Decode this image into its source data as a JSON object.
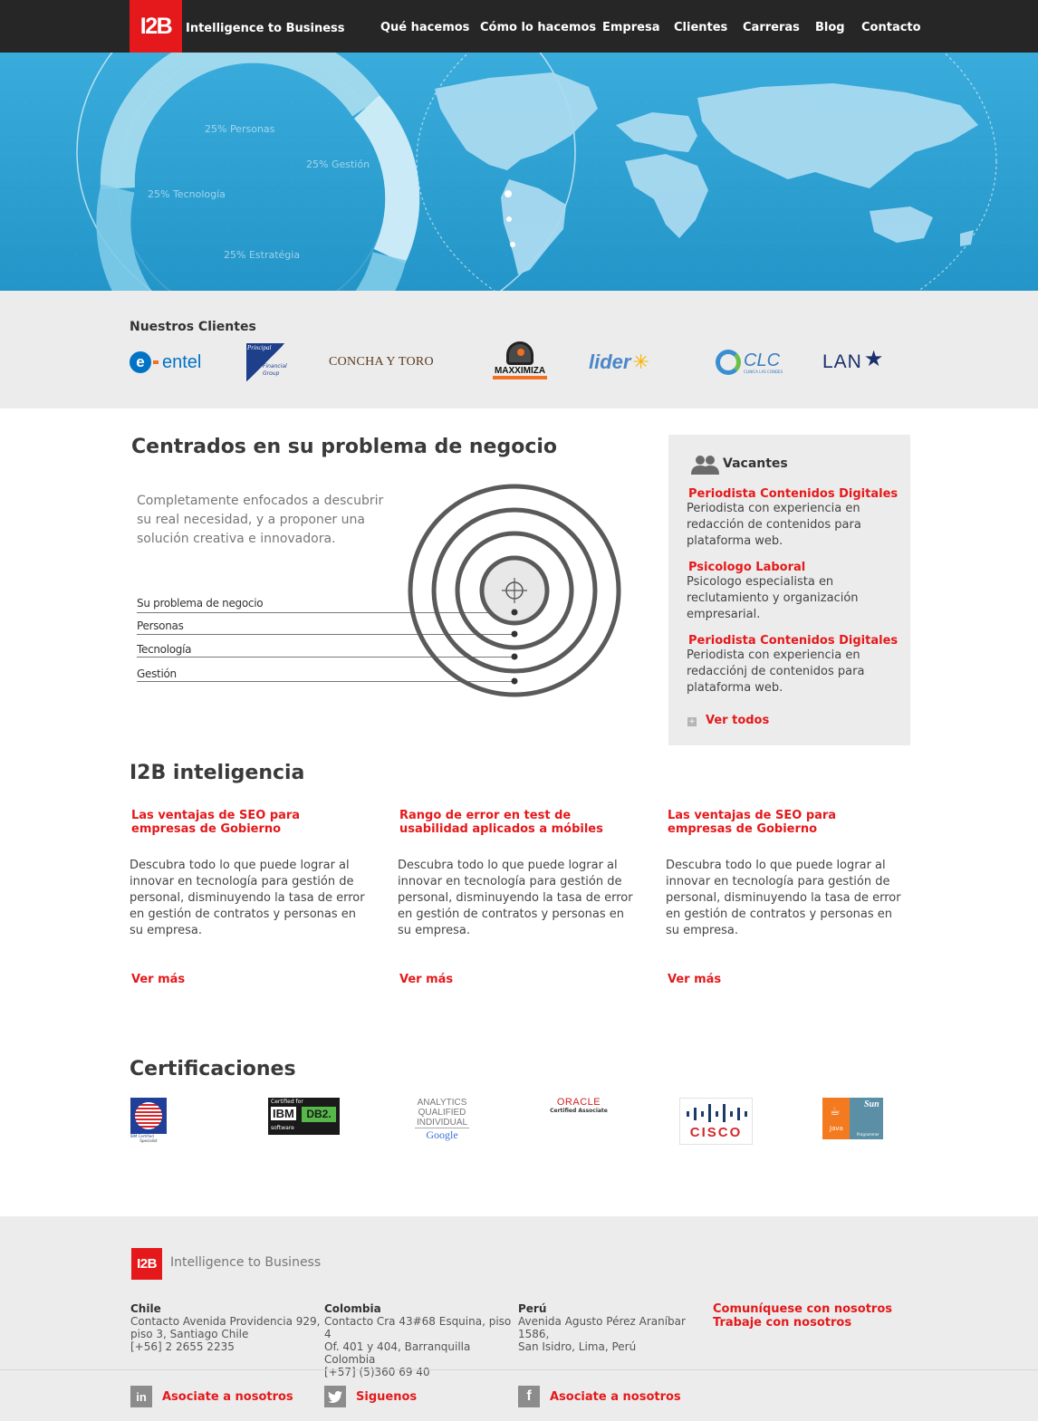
{
  "brand": {
    "logo": "I2B",
    "tagline": "Intelligence to Business"
  },
  "nav": [
    {
      "label": "Qué hacemos"
    },
    {
      "label": "Cómo lo hacemos"
    },
    {
      "label": "Empresa"
    },
    {
      "label": "Clientes"
    },
    {
      "label": "Carreras"
    },
    {
      "label": "Blog"
    },
    {
      "label": "Contacto"
    }
  ],
  "hero": {
    "segments": [
      "25% Personas",
      "25% Gestión",
      "25% Tecnología",
      "25% Estratégia"
    ]
  },
  "clients": {
    "title": "Nuestros Clientes",
    "logos": [
      {
        "name": "entel",
        "text": "entel"
      },
      {
        "name": "principal",
        "text": "Principal",
        "sub1": "Financial",
        "sub2": "Group"
      },
      {
        "name": "concha-y-toro",
        "text": "CONCHA Y TORO"
      },
      {
        "name": "maxximiza",
        "text": "MAXXIMIZA"
      },
      {
        "name": "lider",
        "text": "lider"
      },
      {
        "name": "clc",
        "text": "CLC",
        "sub": "CLINICA LAS CONDES"
      },
      {
        "name": "lan",
        "text": "LAN"
      }
    ]
  },
  "problema": {
    "title": "Centrados en su problema de negocio",
    "intro": "Completamente enfocados a descubrir su real necesidad, y a proponer una solución creativa e innovadora.",
    "layers": [
      "Su problema de negocio",
      "Personas",
      "Tecnología",
      "Gestión"
    ]
  },
  "vacantes": {
    "title": "Vacantes",
    "items": [
      {
        "title": "Periodista Contenidos Digitales",
        "desc": "Periodista con experiencia en redacción de contenidos para plataforma web."
      },
      {
        "title": "Psicologo Laboral",
        "desc": "Psicologo especialista en reclutamiento y organización empresarial."
      },
      {
        "title": "Periodista Contenidos Digitales",
        "desc": "Periodista con experiencia en redacciónj de contenidos para plataforma web."
      }
    ],
    "more": "Ver todos"
  },
  "inteligencia": {
    "title": "I2B inteligencia",
    "articles": [
      {
        "title": "Las ventajas de SEO para empresas de Gobierno",
        "body": "Descubra todo lo que puede lograr al innovar en tecnología para gestión de personal, disminuyendo la tasa de error en gestión de contratos y personas en su empresa.",
        "more": "Ver más"
      },
      {
        "title": "Rango de error en test de usabilidad aplicados a móbiles",
        "body": "Descubra todo lo que puede lograr al innovar en tecnología para gestión de personal, disminuyendo la tasa de error en gestión de contratos y personas en su empresa.",
        "more": "Ver más"
      },
      {
        "title": "Las ventajas de SEO para empresas de Gobierno",
        "body": "Descubra todo lo que puede lograr al innovar en tecnología para gestión de personal, disminuyendo la tasa de error en gestión de contratos y personas en su empresa.",
        "more": "Ver más"
      }
    ]
  },
  "certificaciones": {
    "title": "Certificaciones",
    "items": [
      {
        "name": "ibm-certified-specialist",
        "text": "IBM Certified",
        "sub": "Specialist"
      },
      {
        "name": "ibm-db2",
        "text": "Certified for",
        "brand": "IBM",
        "product": "DB2.",
        "sub": "software"
      },
      {
        "name": "google-analytics",
        "line1": "ANALYTICS",
        "line2": "QUALIFIED",
        "line3": "INDIVIDUAL",
        "brand": "Google"
      },
      {
        "name": "oracle",
        "text": "ORACLE",
        "sub": "Certified Associate"
      },
      {
        "name": "cisco",
        "text": "CISCO"
      },
      {
        "name": "sun-java",
        "text": "Sun",
        "sub": "Java",
        "sub2": "Programmer"
      }
    ]
  },
  "footer": {
    "logo": "I2B",
    "tagline": "Intelligence to Business",
    "offices": [
      {
        "country": "Chile",
        "l1": "Contacto Avenida Providencia 929,",
        "l2": "piso 3, Santiago Chile",
        "l3": "[+56] 2 2655 2235"
      },
      {
        "country": "Colombia",
        "l1": "Contacto Cra 43#68 Esquina, piso 4",
        "l2": "Of. 401 y 404, Barranquilla Colombia",
        "l3": "[+57] (5)360 69 40"
      },
      {
        "country": "Perú",
        "l1": "Avenida Agusto Pérez Araníbar 1586,",
        "l2": "San Isidro, Lima, Perú",
        "l3": ""
      }
    ],
    "links": [
      "Comuníquese con nosotros",
      "Trabaje con nosotros"
    ],
    "social": [
      {
        "icon": "linkedin-icon",
        "glyph": "in",
        "label": "Asociate a nosotros"
      },
      {
        "icon": "twitter-icon",
        "glyph": "t",
        "label": "Siguenos"
      },
      {
        "icon": "facebook-icon",
        "glyph": "f",
        "label": "Asociate a nosotros"
      }
    ]
  },
  "colors": {
    "accent": "#e5191b",
    "header": "#262626",
    "hero": "#2aa0d2",
    "panel": "#ececec"
  }
}
